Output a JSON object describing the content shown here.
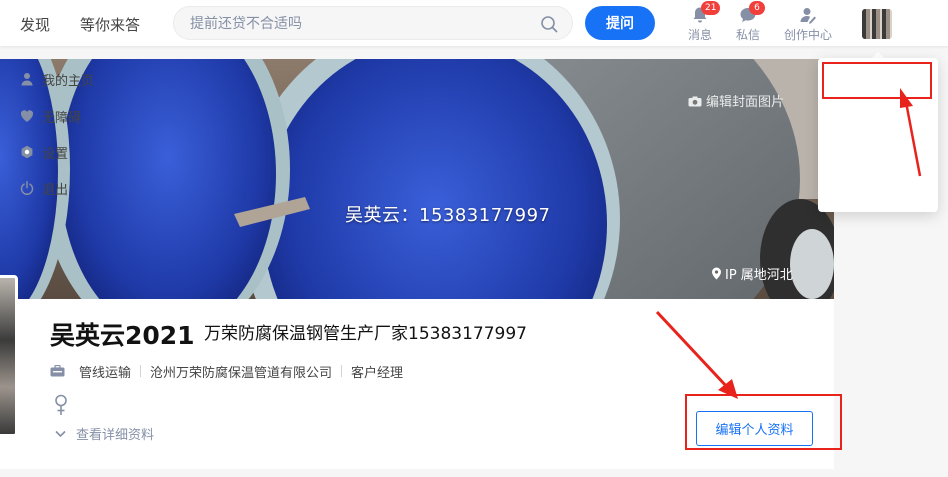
{
  "topbar": {
    "nav": [
      "发现",
      "等你来答"
    ],
    "search_placeholder": "提前还贷不合适吗",
    "ask_label": "提问",
    "messages": {
      "label": "消息",
      "count": "21"
    },
    "private_messages": {
      "label": "私信",
      "count": "6"
    },
    "creator_label": "创作中心"
  },
  "cover": {
    "text": "吴英云：15383177997",
    "edit_label": "编辑封面图片",
    "ip_location": "IP 属地河北"
  },
  "profile": {
    "name": "吴英云2021",
    "headline": "万荣防腐保温钢管生产厂家15383177997",
    "industry": "管线运输",
    "company": "沧州万荣防腐保温管道有限公司",
    "position": "客户经理",
    "details_toggle": "查看详细资料",
    "edit_profile_label": "编辑个人资料"
  },
  "dropdown": {
    "items": [
      "我的主页",
      "无障碍",
      "设置",
      "退出"
    ]
  },
  "colors": {
    "brand_blue": "#1772f6",
    "annotation_red": "#e8231c",
    "badge_red": "#f1403c"
  }
}
